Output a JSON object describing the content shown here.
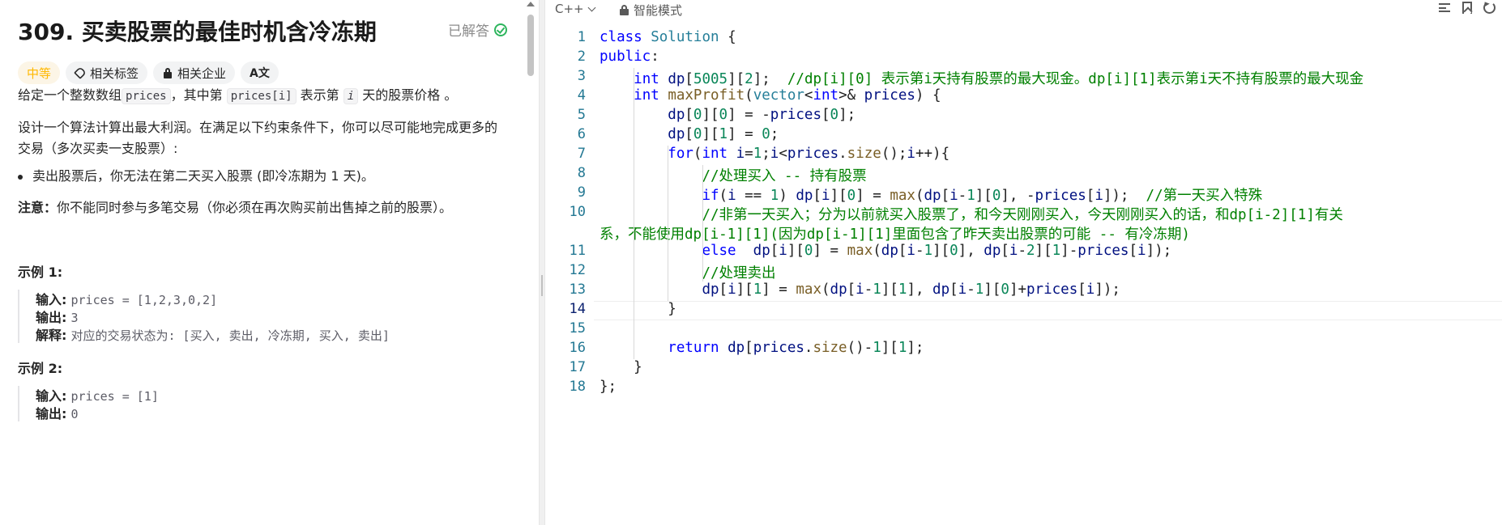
{
  "problem": {
    "title": "309. 买卖股票的最佳时机含冷冻期",
    "status": "已解答",
    "difficulty": "中等",
    "tags": [
      "相关标签",
      "相关企业"
    ],
    "translate_glyph": "A文",
    "desc1_a": "给定一个整数数组",
    "desc1_code1": "prices",
    "desc1_b": "，其中第 ",
    "desc1_code2": "prices[i]",
    "desc1_c": " 表示第 ",
    "desc1_var": "i",
    "desc1_d": " 天的股票价格 。",
    "desc2": "设计一个算法计算出最大利润。在满足以下约束条件下，你可以尽可能地完成更多的交易（多次买卖一支股票）:",
    "bullet": "卖出股票后，你无法在第二天买入股票 (即冷冻期为 1 天)。",
    "note_label": "注意：",
    "note_text": "你不能同时参与多笔交易（你必须在再次购买前出售掉之前的股票）。",
    "example1_title": "示例 1:",
    "example1_input_label": "输入:",
    "example1_input": "prices = [1,2,3,0,2]",
    "example1_output_label": "输出:",
    "example1_output": "3",
    "example1_explain_label": "解释:",
    "example1_explain": "对应的交易状态为: [买入, 卖出, 冷冻期, 买入, 卖出]",
    "example2_title": "示例 2:",
    "example2_input_label": "输入:",
    "example2_input": "prices = [1]",
    "example2_output_label": "输出:",
    "example2_output": "0"
  },
  "editor": {
    "language": "C++",
    "mode": "智能模式",
    "current_line": 14,
    "line_numbers": [
      "1",
      "2",
      "3",
      "4",
      "5",
      "6",
      "7",
      "8",
      "9",
      "10",
      "",
      "11",
      "12",
      "13",
      "14",
      "15",
      "16",
      "17",
      "18"
    ],
    "lines": [
      [
        [
          "kw",
          "class"
        ],
        [
          "op",
          " "
        ],
        [
          "cls",
          "Solution"
        ],
        [
          "op",
          " {"
        ]
      ],
      [
        [
          "kw",
          "public"
        ],
        [
          "op",
          ":"
        ]
      ],
      [
        [
          "op",
          "    "
        ],
        [
          "kw",
          "int"
        ],
        [
          "op",
          " "
        ],
        [
          "vr",
          "dp"
        ],
        [
          "op",
          "["
        ],
        [
          "num",
          "5005"
        ],
        [
          "op",
          "]["
        ],
        [
          "num",
          "2"
        ],
        [
          "op",
          "];  "
        ],
        [
          "cm",
          "//dp[i][0] 表示第i天持有股票的最大现金。dp[i][1]表示第i天不持有股票的最大现金"
        ]
      ],
      [
        [
          "op",
          "    "
        ],
        [
          "kw",
          "int"
        ],
        [
          "op",
          " "
        ],
        [
          "fn",
          "maxProfit"
        ],
        [
          "op",
          "("
        ],
        [
          "cls",
          "vector"
        ],
        [
          "op",
          "<"
        ],
        [
          "kw",
          "int"
        ],
        [
          "op",
          ">& "
        ],
        [
          "vr",
          "prices"
        ],
        [
          "op",
          ") {"
        ]
      ],
      [
        [
          "op",
          "        "
        ],
        [
          "vr",
          "dp"
        ],
        [
          "op",
          "["
        ],
        [
          "num",
          "0"
        ],
        [
          "op",
          "]["
        ],
        [
          "num",
          "0"
        ],
        [
          "op",
          "] = -"
        ],
        [
          "vr",
          "prices"
        ],
        [
          "op",
          "["
        ],
        [
          "num",
          "0"
        ],
        [
          "op",
          "];"
        ]
      ],
      [
        [
          "op",
          "        "
        ],
        [
          "vr",
          "dp"
        ],
        [
          "op",
          "["
        ],
        [
          "num",
          "0"
        ],
        [
          "op",
          "]["
        ],
        [
          "num",
          "1"
        ],
        [
          "op",
          "] = "
        ],
        [
          "num",
          "0"
        ],
        [
          "op",
          ";"
        ]
      ],
      [
        [
          "op",
          "        "
        ],
        [
          "kw",
          "for"
        ],
        [
          "op",
          "("
        ],
        [
          "kw",
          "int"
        ],
        [
          "op",
          " "
        ],
        [
          "vr",
          "i"
        ],
        [
          "op",
          "="
        ],
        [
          "num",
          "1"
        ],
        [
          "op",
          ";"
        ],
        [
          "vr",
          "i"
        ],
        [
          "op",
          "<"
        ],
        [
          "vr",
          "prices"
        ],
        [
          "op",
          "."
        ],
        [
          "fn",
          "size"
        ],
        [
          "op",
          "();"
        ],
        [
          "vr",
          "i"
        ],
        [
          "op",
          "++){"
        ]
      ],
      [
        [
          "op",
          "            "
        ],
        [
          "cm",
          "//处理买入 -- 持有股票"
        ]
      ],
      [
        [
          "op",
          "            "
        ],
        [
          "kw",
          "if"
        ],
        [
          "op",
          "("
        ],
        [
          "vr",
          "i"
        ],
        [
          "op",
          " == "
        ],
        [
          "num",
          "1"
        ],
        [
          "op",
          ") "
        ],
        [
          "vr",
          "dp"
        ],
        [
          "op",
          "["
        ],
        [
          "vr",
          "i"
        ],
        [
          "op",
          "]["
        ],
        [
          "num",
          "0"
        ],
        [
          "op",
          "] = "
        ],
        [
          "fn",
          "max"
        ],
        [
          "op",
          "("
        ],
        [
          "vr",
          "dp"
        ],
        [
          "op",
          "["
        ],
        [
          "vr",
          "i"
        ],
        [
          "op",
          "-"
        ],
        [
          "num",
          "1"
        ],
        [
          "op",
          "]["
        ],
        [
          "num",
          "0"
        ],
        [
          "op",
          "], -"
        ],
        [
          "vr",
          "prices"
        ],
        [
          "op",
          "["
        ],
        [
          "vr",
          "i"
        ],
        [
          "op",
          "]);  "
        ],
        [
          "cm",
          "//第一天买入特殊"
        ]
      ],
      [
        [
          "op",
          "            "
        ],
        [
          "cm",
          "//非第一天买入；分为以前就买入股票了，和今天刚刚买入，今天刚刚买入的话，和dp[i-2][1]有关"
        ]
      ],
      [
        [
          "cm",
          "系，不能使用dp[i-1][1](因为dp[i-1][1]里面包含了昨天卖出股票的可能 -- 有冷冻期)"
        ]
      ],
      [
        [
          "op",
          "            "
        ],
        [
          "kw",
          "else"
        ],
        [
          "op",
          "  "
        ],
        [
          "vr",
          "dp"
        ],
        [
          "op",
          "["
        ],
        [
          "vr",
          "i"
        ],
        [
          "op",
          "]["
        ],
        [
          "num",
          "0"
        ],
        [
          "op",
          "] = "
        ],
        [
          "fn",
          "max"
        ],
        [
          "op",
          "("
        ],
        [
          "vr",
          "dp"
        ],
        [
          "op",
          "["
        ],
        [
          "vr",
          "i"
        ],
        [
          "op",
          "-"
        ],
        [
          "num",
          "1"
        ],
        [
          "op",
          "]["
        ],
        [
          "num",
          "0"
        ],
        [
          "op",
          "], "
        ],
        [
          "vr",
          "dp"
        ],
        [
          "op",
          "["
        ],
        [
          "vr",
          "i"
        ],
        [
          "op",
          "-"
        ],
        [
          "num",
          "2"
        ],
        [
          "op",
          "]["
        ],
        [
          "num",
          "1"
        ],
        [
          "op",
          "]-"
        ],
        [
          "vr",
          "prices"
        ],
        [
          "op",
          "["
        ],
        [
          "vr",
          "i"
        ],
        [
          "op",
          "]);"
        ]
      ],
      [
        [
          "op",
          "            "
        ],
        [
          "cm",
          "//处理卖出"
        ]
      ],
      [
        [
          "op",
          "            "
        ],
        [
          "vr",
          "dp"
        ],
        [
          "op",
          "["
        ],
        [
          "vr",
          "i"
        ],
        [
          "op",
          "]["
        ],
        [
          "num",
          "1"
        ],
        [
          "op",
          "] = "
        ],
        [
          "fn",
          "max"
        ],
        [
          "op",
          "("
        ],
        [
          "vr",
          "dp"
        ],
        [
          "op",
          "["
        ],
        [
          "vr",
          "i"
        ],
        [
          "op",
          "-"
        ],
        [
          "num",
          "1"
        ],
        [
          "op",
          "]["
        ],
        [
          "num",
          "1"
        ],
        [
          "op",
          "], "
        ],
        [
          "vr",
          "dp"
        ],
        [
          "op",
          "["
        ],
        [
          "vr",
          "i"
        ],
        [
          "op",
          "-"
        ],
        [
          "num",
          "1"
        ],
        [
          "op",
          "]["
        ],
        [
          "num",
          "0"
        ],
        [
          "op",
          "]+"
        ],
        [
          "vr",
          "prices"
        ],
        [
          "op",
          "["
        ],
        [
          "vr",
          "i"
        ],
        [
          "op",
          "]);"
        ]
      ],
      [
        [
          "op",
          "        }"
        ]
      ],
      [
        [
          "op",
          ""
        ]
      ],
      [
        [
          "op",
          "        "
        ],
        [
          "kw",
          "return"
        ],
        [
          "op",
          " "
        ],
        [
          "vr",
          "dp"
        ],
        [
          "op",
          "["
        ],
        [
          "vr",
          "prices"
        ],
        [
          "op",
          "."
        ],
        [
          "fn",
          "size"
        ],
        [
          "op",
          "()-"
        ],
        [
          "num",
          "1"
        ],
        [
          "op",
          "]["
        ],
        [
          "num",
          "1"
        ],
        [
          "op",
          "];"
        ]
      ],
      [
        [
          "op",
          "    }"
        ]
      ],
      [
        [
          "op",
          "};"
        ]
      ]
    ]
  }
}
